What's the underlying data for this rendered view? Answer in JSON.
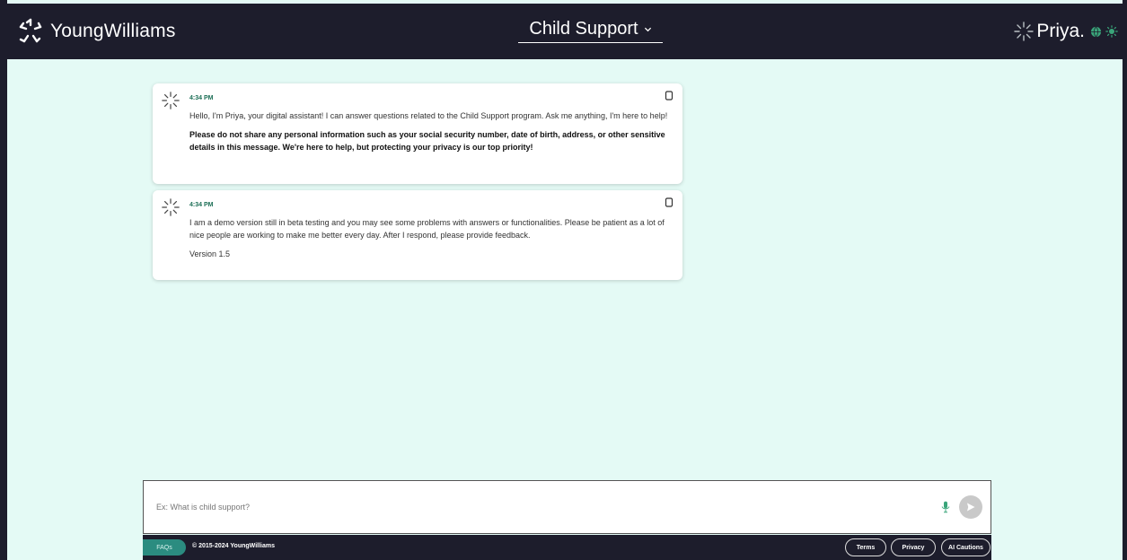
{
  "header": {
    "brand_name": "YoungWilliams",
    "program_label": "Child Support",
    "assistant_name": "Priya."
  },
  "messages": [
    {
      "time": "4:34 PM",
      "paragraphs": [
        "Hello, I'm Priya, your digital assistant! I can answer questions related to the Child Support program. Ask me anything, I'm here to help!",
        "Please do not share any personal information such as your social security number, date of birth, address, or other sensitive details in this message. We're here to help, but protecting your privacy is our top priority!"
      ]
    },
    {
      "time": "4:34 PM",
      "paragraphs": [
        "I am a demo version still in beta testing and you may see some problems with answers or functionalities. Please be patient as a lot of nice people are working to make me better every day. After I respond, please provide feedback.",
        "Version 1.5"
      ]
    }
  ],
  "composer": {
    "placeholder": "Ex: What is child support?"
  },
  "footer": {
    "faq_label": "FAQs",
    "copyright": "© 2015-2024 YoungWilliams",
    "terms_label": "Terms",
    "privacy_label": "Privacy",
    "ai_cautions_label": "AI Cautions"
  },
  "icons": {
    "brand": "youngwilliams-logo-icon",
    "dropdown": "chevron-down-icon",
    "assistant": "priya-sparkle-icon",
    "language": "globe-icon",
    "theme": "sun-icon",
    "copy": "copy-icon",
    "mic": "microphone-icon",
    "send": "send-arrow-icon"
  },
  "colors": {
    "header_bg": "#1d1d2c",
    "page_bg": "#e4faf5",
    "accent": "#2b8c80",
    "timestamp": "#1b6e55",
    "mic": "#3aa57a"
  }
}
